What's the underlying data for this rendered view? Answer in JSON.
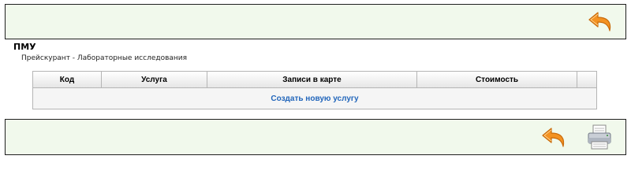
{
  "header": {
    "title": "ПМУ",
    "subtitle": "Прейскурант - Лабораторные исследования"
  },
  "table": {
    "columns": [
      "Код",
      "Услуга",
      "Записи в карте",
      "Стоимость",
      ""
    ],
    "create_link": "Создать новую услугу"
  },
  "icons": {
    "back": "back-arrow-icon",
    "print": "printer-icon"
  },
  "colors": {
    "panel_bg": "#f1f9ec",
    "arrow_orange": "#f39222",
    "link_blue": "#2266bb"
  }
}
